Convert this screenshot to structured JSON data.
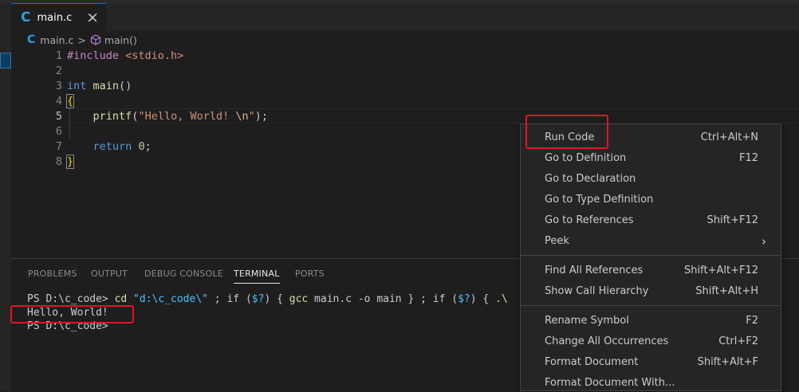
{
  "editor_tab": {
    "icon": "c-language-icon",
    "label": "main.c",
    "close": "×"
  },
  "breadcrumb": {
    "file": "main.c",
    "separator": ">",
    "symbol": "main()"
  },
  "code_lines": [
    {
      "n": "1",
      "parts": [
        [
          "kw-pre",
          "#include "
        ],
        [
          "str",
          "<stdio.h>"
        ]
      ]
    },
    {
      "n": "2",
      "parts": []
    },
    {
      "n": "3",
      "parts": [
        [
          "kw",
          "int"
        ],
        [
          "plain",
          " "
        ],
        [
          "fn",
          "main"
        ],
        [
          "plain",
          "()"
        ]
      ]
    },
    {
      "n": "4",
      "parts": [
        [
          "brace",
          "{"
        ]
      ]
    },
    {
      "n": "5",
      "parts": [
        [
          "plain",
          "    "
        ],
        [
          "fn",
          "printf"
        ],
        [
          "plain",
          "("
        ],
        [
          "str",
          "\"Hello, World! "
        ],
        [
          "esc",
          "\\n"
        ],
        [
          "str",
          "\""
        ],
        [
          "plain",
          ");"
        ]
      ]
    },
    {
      "n": "6",
      "parts": []
    },
    {
      "n": "7",
      "parts": [
        [
          "plain",
          "    "
        ],
        [
          "kw",
          "return"
        ],
        [
          "plain",
          " "
        ],
        [
          "num",
          "0"
        ],
        [
          "plain",
          ";"
        ]
      ]
    },
    {
      "n": "8",
      "parts": [
        [
          "brace",
          "}"
        ]
      ]
    }
  ],
  "panel": {
    "tabs": [
      "PROBLEMS",
      "OUTPUT",
      "DEBUG CONSOLE",
      "TERMINAL",
      "PORTS"
    ],
    "active_tab": "TERMINAL"
  },
  "terminal": {
    "prompt1": "PS D:\\c_code> ",
    "cmd_cd": "cd",
    "cmd_cd_arg": " \"d:\\c_code\\\"",
    "cmd_rest1": " ; if (",
    "cmd_var1": "$?",
    "cmd_rest2": ") { ",
    "cmd_gcc": "gcc",
    "cmd_gcc_args": " main.c -o main",
    "cmd_rest3": " } ; if (",
    "cmd_var2": "$?",
    "cmd_rest4": ") { ",
    "cmd_tail": ".\\",
    "output": "Hello, World!",
    "prompt2": "PS D:\\c_code>"
  },
  "context_menu": {
    "items": [
      {
        "label": "Run Code",
        "shortcut": "Ctrl+Alt+N"
      },
      {
        "label": "Go to Definition",
        "shortcut": "F12"
      },
      {
        "label": "Go to Declaration",
        "shortcut": ""
      },
      {
        "label": "Go to Type Definition",
        "shortcut": ""
      },
      {
        "label": "Go to References",
        "shortcut": "Shift+F12"
      },
      {
        "label": "Peek",
        "shortcut": "",
        "submenu": "chevron-right-icon"
      },
      {
        "label": "Find All References",
        "shortcut": "Shift+Alt+F12"
      },
      {
        "label": "Show Call Hierarchy",
        "shortcut": "Shift+Alt+H"
      },
      {
        "label": "Rename Symbol",
        "shortcut": "F2"
      },
      {
        "label": "Change All Occurrences",
        "shortcut": "Ctrl+F2"
      },
      {
        "label": "Format Document",
        "shortcut": "Shift+Alt+F"
      },
      {
        "label": "Format Document With...",
        "shortcut": ""
      }
    ]
  },
  "colors": {
    "highlight_box": "#e81123",
    "accent": "#007acc",
    "c_icon": "#2b9fd9"
  }
}
